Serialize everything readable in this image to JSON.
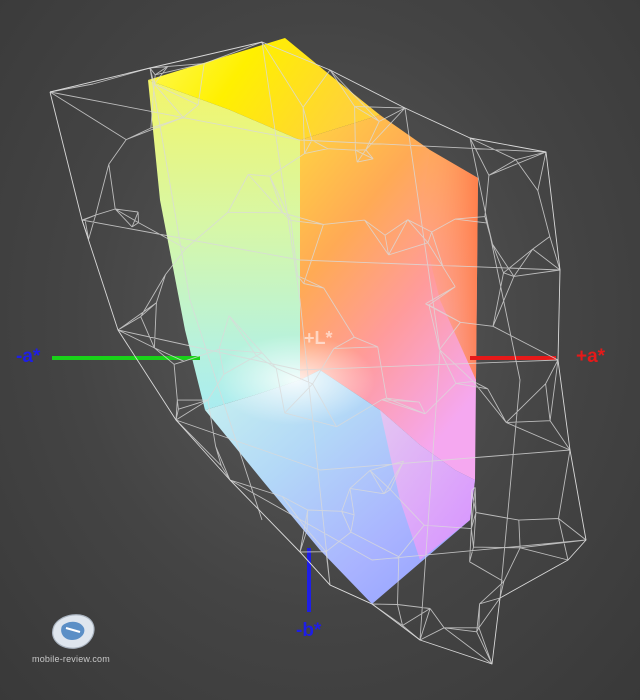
{
  "axes": {
    "neg_a": {
      "label": "-a*",
      "color": "#1e1ee6",
      "line_color": "#19d219"
    },
    "pos_a": {
      "label": "+a*",
      "color": "#e61919",
      "line_color": "#e61919"
    },
    "neg_b": {
      "label": "-b*",
      "color": "#1e1ee6",
      "line_color": "#1e1ee6"
    },
    "pos_l": {
      "label": "+L*",
      "color": "#ffffff"
    }
  },
  "colors": {
    "background": "#464646",
    "wireframe": "#d9d9d9"
  },
  "watermark": {
    "icon": "mobile-review-logo-icon",
    "text": "mobile-review.com"
  }
}
